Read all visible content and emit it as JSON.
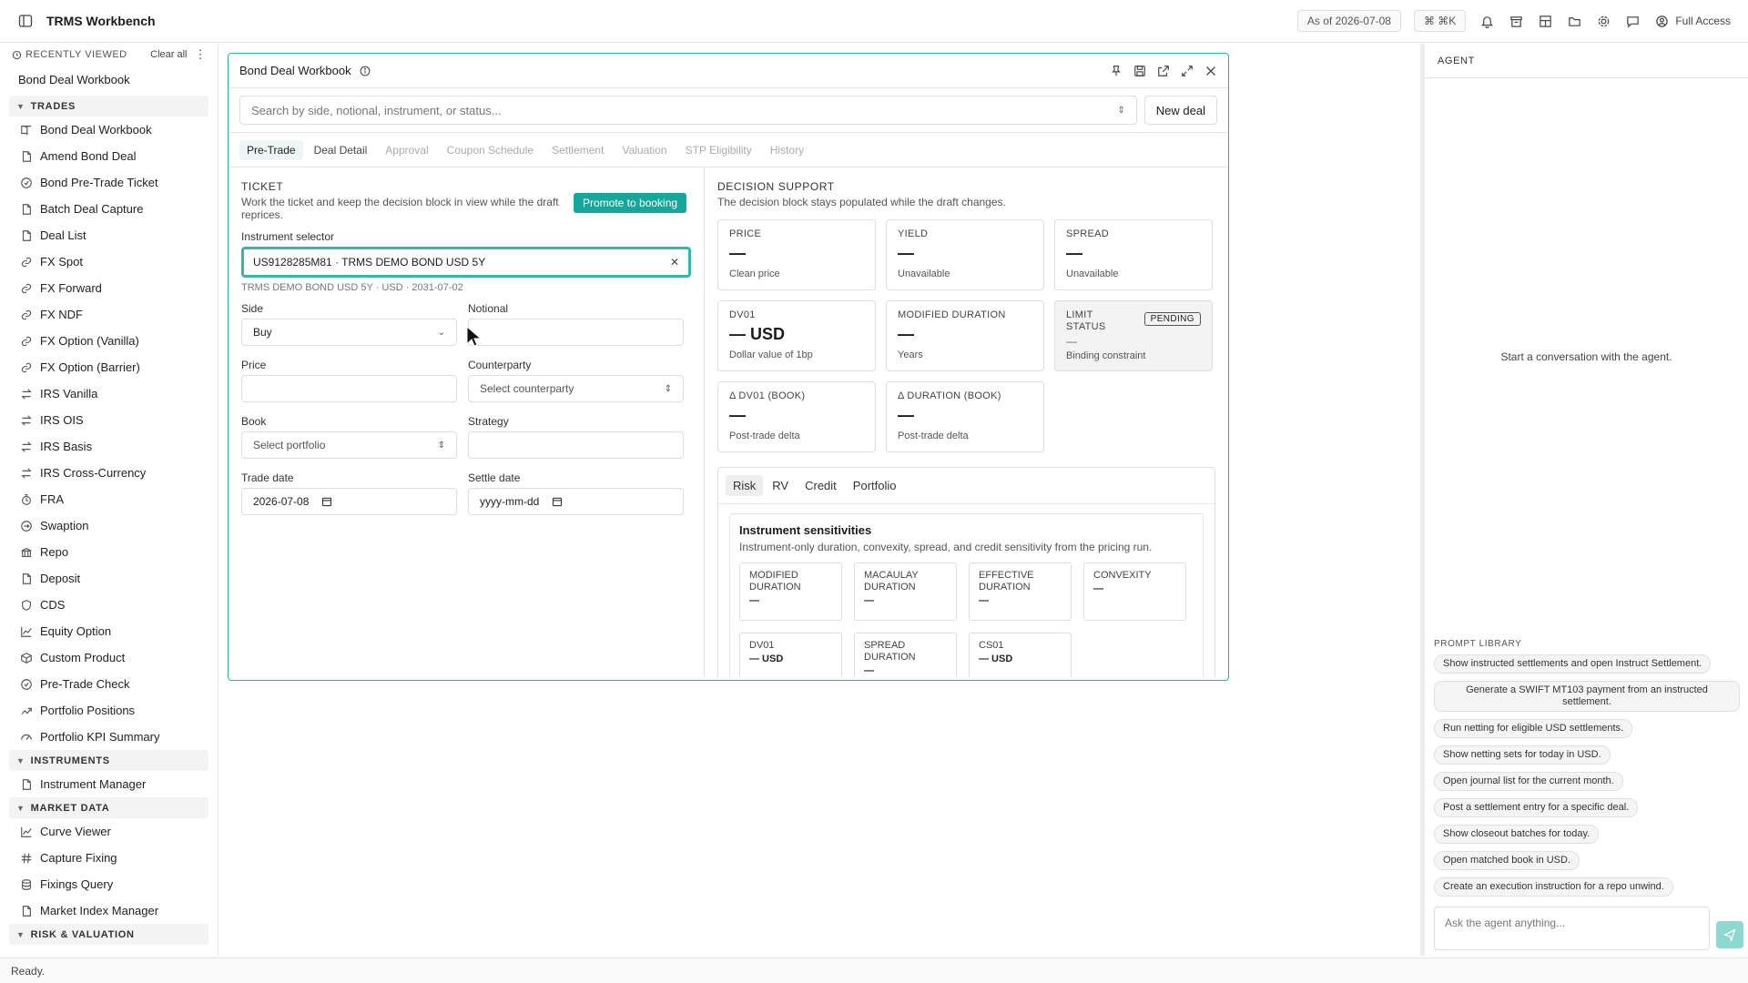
{
  "app": {
    "title": "TRMS Workbench",
    "as_of": "As of 2026-07-08",
    "shortcut": "⌘ ⌘K",
    "access": "Full Access"
  },
  "sidebar": {
    "recently_viewed": "RECENTLY VIEWED",
    "clear_all": "Clear all",
    "recent_item": "Bond Deal Workbook",
    "trades_header": "TRADES",
    "trades": [
      {
        "label": "Bond Deal Workbook",
        "icon": "book-icon"
      },
      {
        "label": "Amend Bond Deal",
        "icon": "file-icon"
      },
      {
        "label": "Bond Pre-Trade Ticket",
        "icon": "check-circle-icon"
      },
      {
        "label": "Batch Deal Capture",
        "icon": "file-icon"
      },
      {
        "label": "Deal List",
        "icon": "file-icon"
      },
      {
        "label": "FX Spot",
        "icon": "link-icon"
      },
      {
        "label": "FX Forward",
        "icon": "link-icon"
      },
      {
        "label": "FX NDF",
        "icon": "link-icon"
      },
      {
        "label": "FX Option (Vanilla)",
        "icon": "link-icon"
      },
      {
        "label": "FX Option (Barrier)",
        "icon": "link-icon"
      },
      {
        "label": "IRS Vanilla",
        "icon": "swap-icon"
      },
      {
        "label": "IRS OIS",
        "icon": "swap-icon"
      },
      {
        "label": "IRS Basis",
        "icon": "swap-icon"
      },
      {
        "label": "IRS Cross-Currency",
        "icon": "swap-icon"
      },
      {
        "label": "FRA",
        "icon": "clock-icon"
      },
      {
        "label": "Swaption",
        "icon": "swaption-icon"
      },
      {
        "label": "Repo",
        "icon": "bank-icon"
      },
      {
        "label": "Deposit",
        "icon": "file-icon"
      },
      {
        "label": "CDS",
        "icon": "shield-icon"
      },
      {
        "label": "Equity Option",
        "icon": "chart-line-icon"
      },
      {
        "label": "Custom Product",
        "icon": "cube-icon"
      },
      {
        "label": "Pre-Trade Check",
        "icon": "check-circle-icon"
      },
      {
        "label": "Portfolio Positions",
        "icon": "trend-icon"
      },
      {
        "label": "Portfolio KPI Summary",
        "icon": "gauge-icon"
      }
    ],
    "instruments_header": "INSTRUMENTS",
    "instruments": [
      {
        "label": "Instrument Manager",
        "icon": "file-icon"
      }
    ],
    "market_header": "MARKET DATA",
    "market": [
      {
        "label": "Curve Viewer",
        "icon": "chart-line-icon"
      },
      {
        "label": "Capture Fixing",
        "icon": "hash-icon"
      },
      {
        "label": "Fixings Query",
        "icon": "database-icon"
      },
      {
        "label": "Market Index Manager",
        "icon": "file-icon"
      }
    ],
    "risk_header": "RISK & VALUATION"
  },
  "status": "Ready.",
  "workbook": {
    "title": "Bond Deal Workbook",
    "search_placeholder": "Search by side, notional, instrument, or status...",
    "new_deal": "New deal",
    "tabs": [
      "Pre-Trade",
      "Deal Detail",
      "Approval",
      "Coupon Schedule",
      "Settlement",
      "Valuation",
      "STP Eligibility",
      "History"
    ],
    "ticket": {
      "heading": "TICKET",
      "desc": "Work the ticket and keep the decision block in view while the draft reprices.",
      "promote": "Promote to booking",
      "instrument_label": "Instrument selector",
      "instrument_value": "US9128285M81 · TRMS DEMO BOND USD 5Y",
      "instrument_hint": "TRMS DEMO BOND USD 5Y · USD · 2031-07-02",
      "side_label": "Side",
      "side_value": "Buy",
      "notional_label": "Notional",
      "notional_value": "",
      "price_label": "Price",
      "price_value": "",
      "counterparty_label": "Counterparty",
      "counterparty_placeholder": "Select counterparty",
      "book_label": "Book",
      "book_placeholder": "Select portfolio",
      "strategy_label": "Strategy",
      "strategy_value": "",
      "trade_date_label": "Trade date",
      "trade_date_value": "2026-07-08",
      "settle_date_label": "Settle date",
      "settle_date_placeholder": "yyyy-mm-dd"
    },
    "decision": {
      "heading": "DECISION SUPPORT",
      "desc": "The decision block stays populated while the draft changes.",
      "cards": [
        {
          "title": "PRICE",
          "value": "—",
          "sub": "Clean price"
        },
        {
          "title": "YIELD",
          "value": "—",
          "sub": "Unavailable"
        },
        {
          "title": "SPREAD",
          "value": "—",
          "sub": "Unavailable"
        },
        {
          "title": "DV01",
          "value": "— USD",
          "sub": "Dollar value of 1bp"
        },
        {
          "title": "MODIFIED DURATION",
          "value": "—",
          "sub": "Years"
        },
        {
          "title": "LIMIT STATUS",
          "value": "—",
          "sub": "Binding constraint",
          "badge": "PENDING"
        },
        {
          "title": "Δ DV01 (BOOK)",
          "value": "—",
          "sub": "Post-trade delta"
        },
        {
          "title": "Δ DURATION (BOOK)",
          "value": "—",
          "sub": "Post-trade delta"
        }
      ],
      "subtabs": [
        "Risk",
        "RV",
        "Credit",
        "Portfolio"
      ],
      "sens_title": "Instrument sensitivities",
      "sens_desc": "Instrument-only duration, convexity, spread, and credit sensitivity from the pricing run.",
      "sens": [
        {
          "title": "MODIFIED DURATION",
          "value": "—"
        },
        {
          "title": "MACAULAY DURATION",
          "value": "—"
        },
        {
          "title": "EFFECTIVE DURATION",
          "value": "—"
        },
        {
          "title": "CONVEXITY",
          "value": "—"
        },
        {
          "title": "DV01",
          "value": "— USD"
        },
        {
          "title": "SPREAD DURATION",
          "value": "—"
        },
        {
          "title": "CS01",
          "value": "— USD"
        }
      ]
    }
  },
  "agent": {
    "title": "AGENT",
    "empty": "Start a conversation with the agent.",
    "library_title": "PROMPT LIBRARY",
    "prompts": [
      "Show instructed settlements and open Instruct Settlement.",
      "Generate a SWIFT MT103 payment from an instructed settlement.",
      "Run netting for eligible USD settlements.",
      "Show netting sets for today in USD.",
      "Open journal list for the current month.",
      "Post a settlement entry for a specific deal.",
      "Show closeout batches for today.",
      "Open matched book in USD.",
      "Create an execution instruction for a repo unwind."
    ],
    "input_placeholder": "Ask the agent anything..."
  }
}
